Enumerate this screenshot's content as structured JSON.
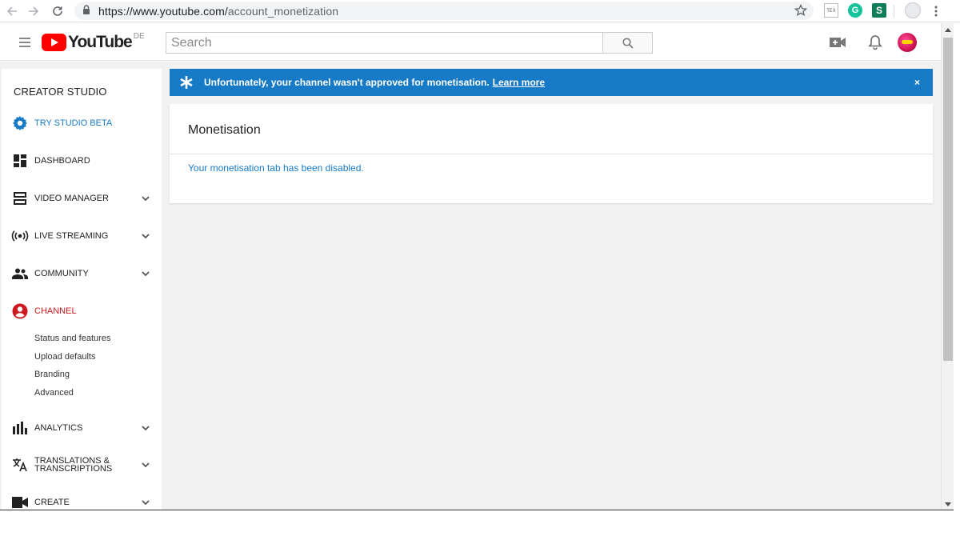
{
  "browser": {
    "url_host": "https://www.youtube.com/",
    "url_path": "account_monetization",
    "ext_tex_label": "TEX",
    "ext_grammarly_label": "G",
    "ext_s_label": "S"
  },
  "header": {
    "logo_text": "YouTube",
    "logo_region": "DE",
    "search_placeholder": "Search"
  },
  "sidebar": {
    "title": "CREATOR STUDIO",
    "items": [
      {
        "label": "TRY STUDIO BETA",
        "icon": "gear-icon"
      },
      {
        "label": "DASHBOARD",
        "icon": "dashboard-icon"
      },
      {
        "label": "VIDEO MANAGER",
        "icon": "video-manager-icon"
      },
      {
        "label": "LIVE STREAMING",
        "icon": "live-streaming-icon"
      },
      {
        "label": "COMMUNITY",
        "icon": "community-icon"
      },
      {
        "label": "CHANNEL",
        "icon": "channel-icon"
      },
      {
        "label": "ANALYTICS",
        "icon": "analytics-icon"
      },
      {
        "label": "TRANSLATIONS &",
        "label2": "TRANSCRIPTIONS",
        "icon": "translate-icon"
      },
      {
        "label": "CREATE",
        "icon": "create-icon"
      }
    ],
    "channel_sub": [
      "Status and features",
      "Upload defaults",
      "Branding",
      "Advanced"
    ]
  },
  "banner": {
    "text": "Unfortunately, your channel wasn't approved for monetisation.",
    "link": "Learn more",
    "close": "×",
    "color": "#167ac6"
  },
  "card": {
    "title": "Monetisation",
    "message": "Your monetisation tab has been disabled."
  },
  "colors": {
    "accent_blue": "#167ac6",
    "active_red": "#cc181e",
    "logo_red": "#ff0000"
  }
}
